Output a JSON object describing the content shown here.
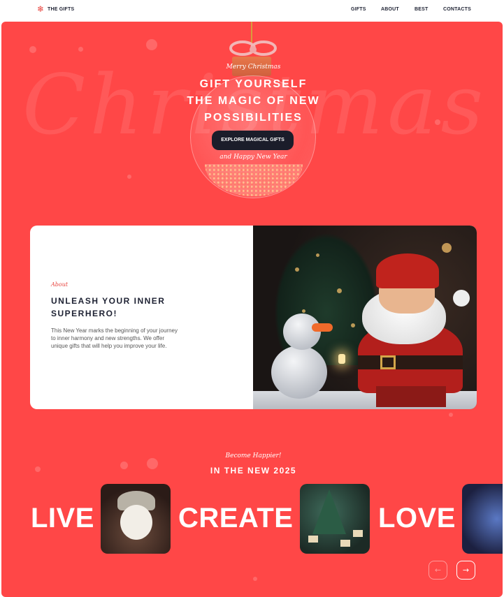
{
  "header": {
    "logo_text": "THE GIFTS",
    "logo_icon": "snowflake-icon",
    "nav": [
      "GIFTS",
      "ABOUT",
      "BEST",
      "CONTACTS"
    ]
  },
  "hero": {
    "background_script": "Christmas",
    "script_top": "Merry Christmas",
    "title_lines": [
      "GIFT YOURSELF",
      "THE MAGIC OF NEW",
      "POSSIBILITIES"
    ],
    "button_label": "EXPLORE MAGICAL GIFTS",
    "script_bottom": "and Happy New Year"
  },
  "about": {
    "label": "About",
    "title_lines": [
      "UNLEASH YOUR INNER",
      "SUPERHERO!"
    ],
    "body_lines": [
      "This New Year marks the beginning of your journey",
      "to inner harmony and new strengths. We offer",
      "unique gifts that will help you improve your life."
    ]
  },
  "happier": {
    "script": "Become Happier!",
    "title": "IN THE NEW 2025"
  },
  "words": [
    "LIVE",
    "CREATE",
    "LOVE"
  ],
  "colors": {
    "accent": "#ff4747",
    "dark": "#1b1d2a",
    "text": "#1e2233"
  },
  "slider": {
    "prev_icon": "arrow-left-icon",
    "next_icon": "arrow-right-icon"
  }
}
